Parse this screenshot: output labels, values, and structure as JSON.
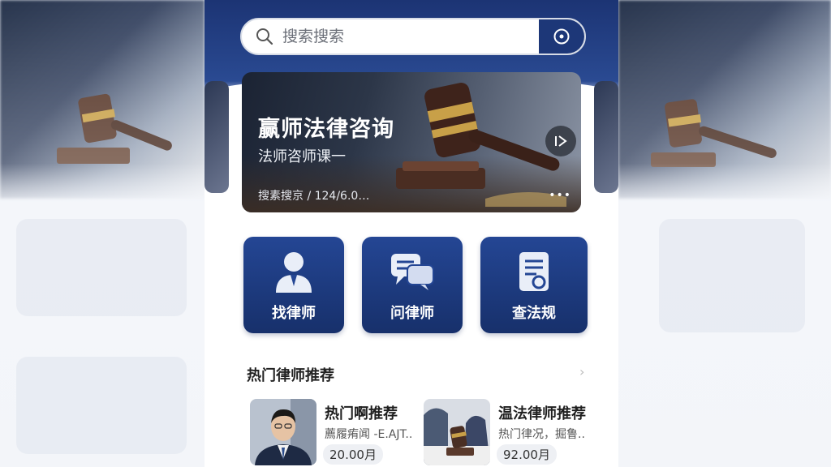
{
  "search": {
    "placeholder": "搜索搜索"
  },
  "banner": {
    "title": "赢师法律咨询",
    "subtitle": "法师咨师课一",
    "meta": "搜素搜京 / 124/6.0…",
    "dots": "•••"
  },
  "actions": [
    {
      "label": "找律师",
      "icon": "lawyer-icon"
    },
    {
      "label": "问律师",
      "icon": "chat-icon"
    },
    {
      "label": "查法规",
      "icon": "document-icon"
    }
  ],
  "section": {
    "title": "热门律师推荐",
    "more": "›"
  },
  "cards": [
    {
      "title": "热门啊推荐",
      "desc": "薦履痏闻 -E.AJT..",
      "price": "20.00月"
    },
    {
      "title": "温法律师推荐",
      "desc": "热门律况，掘鲁..",
      "price": "92.00月"
    }
  ],
  "colors": {
    "primary": "#1d3778",
    "accent": "#244694",
    "background": "#ffffff"
  }
}
